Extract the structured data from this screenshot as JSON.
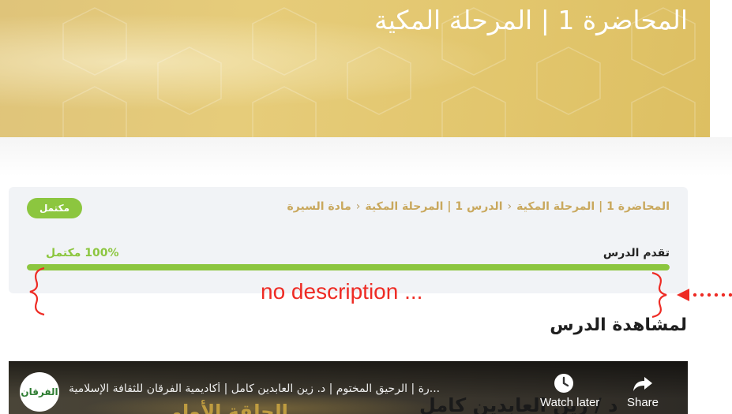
{
  "hero": {
    "title": "المحاضرة 1 | المرحلة المكية"
  },
  "breadcrumb": {
    "items": [
      "المحاضرة 1 | المرحلة المكية",
      "الدرس 1 | المرحلة المكية",
      "مادة السيرة"
    ]
  },
  "status_badge": "مكتمل",
  "progress": {
    "label": "تقدم الدرس",
    "percent_text": "100% مكتمل",
    "value": 100
  },
  "annotation": {
    "text": "no description ..."
  },
  "section_title": "لمشاهدة الدرس",
  "video": {
    "title": "...رة | الرحيق المختوم | د. زين العابدين كامل | أكاديمية الفرقان للثقافة الإسلامية",
    "channel_logo_text": "الفرقان",
    "banner_text": "د / زين العابدين كامل",
    "banner_text_2": "الحلقة الأولى",
    "watch_later": "Watch later",
    "share": "Share"
  },
  "colors": {
    "accent_green": "#8cc63f",
    "breadcrumb_gold": "#c9a85d",
    "hero_gold": "#e2c66d",
    "annotation_red": "#ee2b24"
  }
}
